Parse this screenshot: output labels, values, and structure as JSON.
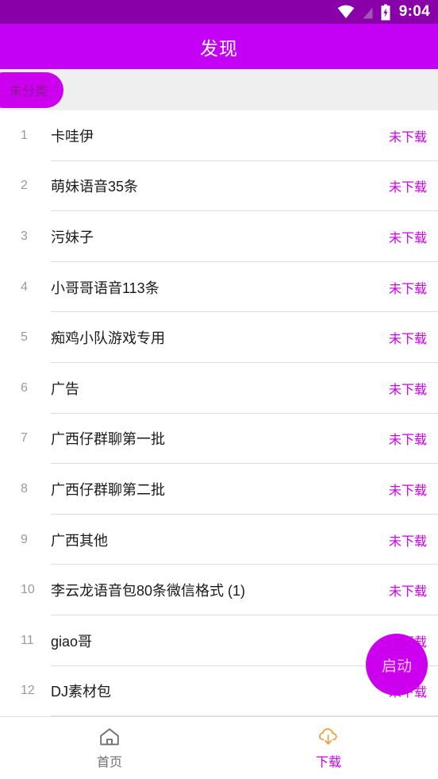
{
  "status_bar": {
    "time": "9:04",
    "icons": [
      "wifi-icon",
      "signal-off-icon",
      "battery-charging-icon"
    ],
    "background_color": "#8A00A8"
  },
  "app_bar": {
    "title": "发现",
    "background_color": "#C400F5",
    "title_color": "#FFFFFF"
  },
  "category_chips": {
    "strip_background": "#F0EFF0",
    "items": [
      {
        "label": "未分类",
        "selected": true,
        "background_color": "#CC00EE",
        "text_color": "#8A1A96"
      }
    ]
  },
  "list": {
    "status_color": "#CC00EE",
    "items": [
      {
        "index": "1",
        "title": "卡哇伊",
        "status": "未下载"
      },
      {
        "index": "2",
        "title": "萌妹语音35条",
        "status": "未下载"
      },
      {
        "index": "3",
        "title": "污妹子",
        "status": "未下载"
      },
      {
        "index": "4",
        "title": "小哥哥语音113条",
        "status": "未下载"
      },
      {
        "index": "5",
        "title": "痴鸡小队游戏专用",
        "status": "未下载"
      },
      {
        "index": "6",
        "title": "广告",
        "status": "未下载"
      },
      {
        "index": "7",
        "title": "广西仔群聊第一批",
        "status": "未下载"
      },
      {
        "index": "8",
        "title": "广西仔群聊第二批",
        "status": "未下载"
      },
      {
        "index": "9",
        "title": "广西其他",
        "status": "未下载"
      },
      {
        "index": "10",
        "title": "李云龙语音包80条微信格式 (1)",
        "status": "未下载"
      },
      {
        "index": "11",
        "title": "giao哥",
        "status": "未下载"
      },
      {
        "index": "12",
        "title": "DJ素材包",
        "status": "未下载"
      }
    ]
  },
  "fab": {
    "label": "启动",
    "background_color": "#CC00EE",
    "text_color": "#F2C8F7"
  },
  "bottom_nav": {
    "items": [
      {
        "label": "首页",
        "icon": "home-icon",
        "active": false,
        "color": "#707070"
      },
      {
        "label": "下载",
        "icon": "cloud-download-icon",
        "active": true,
        "color": "#CC00EE",
        "icon_color": "#E8A33D"
      }
    ]
  }
}
